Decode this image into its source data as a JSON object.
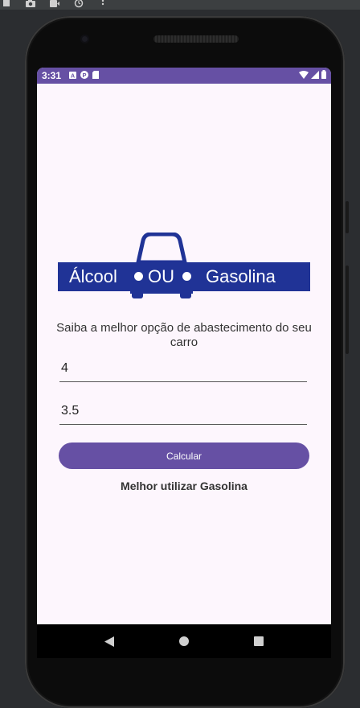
{
  "emulator_toolbar": {
    "icons": [
      "stop-icon",
      "camera-icon",
      "video-icon",
      "rotate-icon",
      "more-icon"
    ]
  },
  "status_bar": {
    "time": "3:31",
    "left_icons": [
      "a-icon",
      "p-icon",
      "sd-card-icon"
    ],
    "right_icons": [
      "wifi-icon",
      "signal-icon",
      "battery-icon"
    ],
    "background_color": "#6650a4"
  },
  "logo": {
    "word_left": "Álcool",
    "word_middle": "OU",
    "word_right": "Gasolina",
    "brand_color": "#203396"
  },
  "main": {
    "subtitle": "Saiba a melhor opção de abastecimento do seu carro",
    "alcool_price_value": "4",
    "gasolina_price_value": "3.5",
    "calculate_label": "Calcular",
    "result_text": "Melhor utilizar Gasolina",
    "accent_color": "#6650a4"
  },
  "nav_bar": {
    "buttons": [
      "back-icon",
      "home-icon",
      "recents-icon"
    ]
  }
}
